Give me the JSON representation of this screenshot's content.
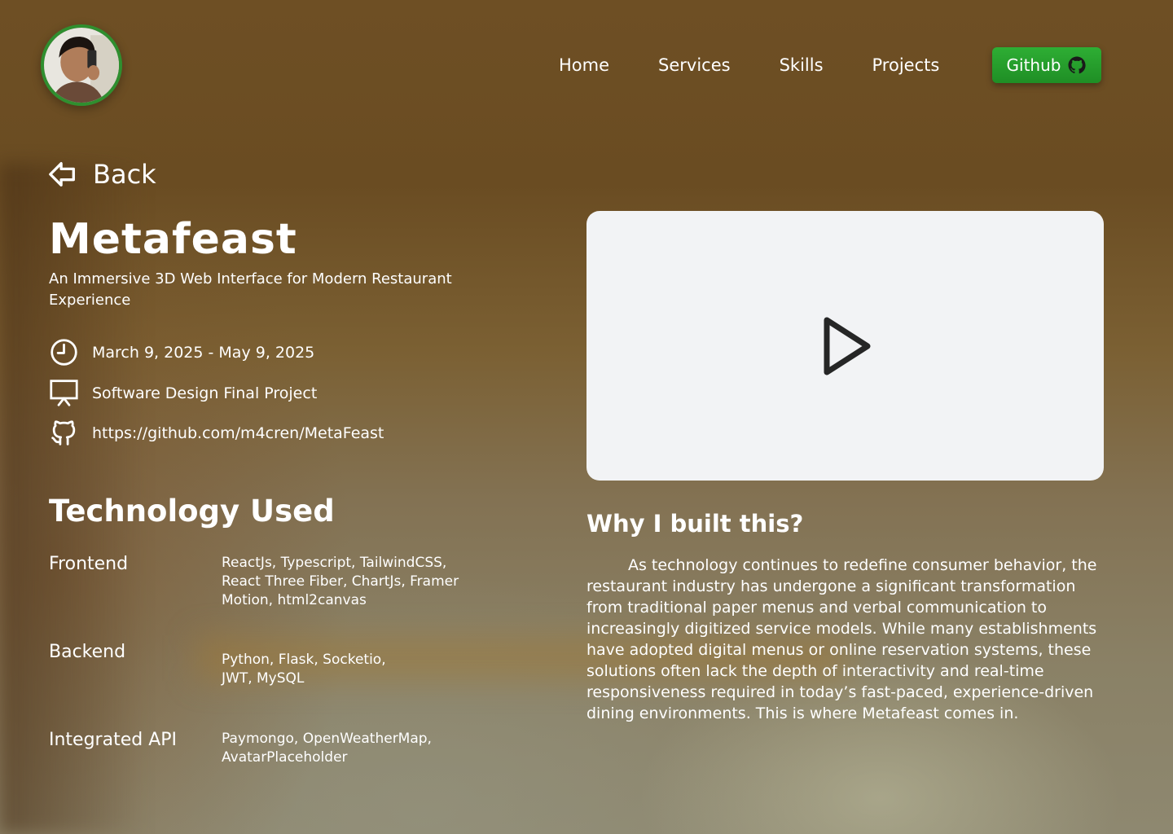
{
  "nav": {
    "items": [
      {
        "label": "Home"
      },
      {
        "label": "Services"
      },
      {
        "label": "Skills"
      },
      {
        "label": "Projects"
      }
    ],
    "github_label": "Github"
  },
  "back": {
    "label": "Back"
  },
  "project": {
    "title": "Metafeast",
    "subtitle": "An Immersive 3D Web Interface for Modern Restaurant Experience",
    "date_range": "March 9, 2025 - May 9, 2025",
    "course": "Software Design Final Project",
    "repo_url": "https://github.com/m4cren/MetaFeast"
  },
  "technology": {
    "heading": "Technology Used",
    "groups": [
      {
        "label": "Frontend",
        "value": "ReactJs, Typescript, TailwindCSS, React Three Fiber, ChartJs, Framer Motion, html2canvas"
      },
      {
        "label": "Backend",
        "value": "Python, Flask, Socketio, JWT, MySQL"
      },
      {
        "label": "Integrated API",
        "value": "Paymongo, OpenWeatherMap, AvatarPlaceholder"
      }
    ]
  },
  "why": {
    "heading": "Why I built this?",
    "text": "As technology continues to redefine consumer behavior, the restaurant industry has undergone a significant transformation from traditional paper menus and verbal communication to increasingly digitized service models. While many establishments have adopted digital menus or online reservation systems, these solutions often lack the depth of interactivity and real-time responsiveness required in today’s fast-paced, experience-driven dining environments. This is where Metafeast comes in."
  },
  "icons": {
    "back": "back-arrow-icon",
    "date": "clock-icon",
    "course": "presentation-icon",
    "repo": "github-icon",
    "video": "play-icon"
  },
  "colors": {
    "accent_green": "#2eae34",
    "avatar_ring": "#2f8f2f",
    "video_bg": "#f2f3f5"
  }
}
